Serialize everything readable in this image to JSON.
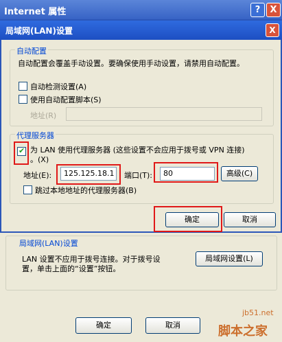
{
  "outer": {
    "title": "Internet 属性",
    "help_btn": "?",
    "close_btn": "X"
  },
  "dialog": {
    "title": "局域网(LAN)设置",
    "close_btn": "X",
    "auto_config": {
      "legend": "自动配置",
      "description": "自动配置会覆盖手动设置。要确保使用手动设置，请禁用自动配置。",
      "auto_detect_label": "自动检测设置(A)",
      "auto_detect_checked": false,
      "use_script_label": "使用自动配置脚本(S)",
      "use_script_checked": false,
      "address_label": "地址(R)",
      "address_value": ""
    },
    "proxy": {
      "legend": "代理服务器",
      "use_proxy_label_line1": "为 LAN 使用代理服务器 (这些设置不会应用于拨号或 VPN 连接)",
      "use_proxy_label_line2": "。(X)",
      "use_proxy_checked": true,
      "address_label": "地址(E):",
      "address_value": "125.125.18.1",
      "port_label": "端口(T):",
      "port_value": "80",
      "advanced_btn": "高级(C)",
      "bypass_label": "跳过本地地址的代理服务器(B)",
      "bypass_checked": false
    },
    "ok_btn": "确定",
    "cancel_btn": "取消"
  },
  "parent": {
    "lan_legend": "局域网(LAN)设置",
    "lan_description_line1": "LAN 设置不应用于拨号连接。对于拨号设",
    "lan_description_line2": "置，单击上面的“设置”按钮。",
    "lan_settings_btn": "局域网设置(L)",
    "ok_btn": "确定",
    "cancel_btn": "取消"
  },
  "watermark": {
    "site": "jb51.net",
    "brand": "脚本之家"
  }
}
